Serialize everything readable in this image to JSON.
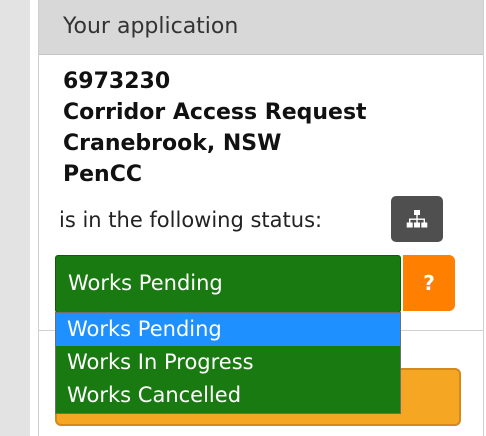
{
  "panel": {
    "title": "Your application"
  },
  "application": {
    "id": "6973230",
    "type": "Corridor Access Request",
    "location": "Cranebrook, NSW",
    "code": "PenCC"
  },
  "status": {
    "label": "is in the following status:",
    "current_value": "Works Pending",
    "options": [
      "Works Pending",
      "Works In Progress",
      "Works Cancelled"
    ],
    "highlighted_option": "Works Pending",
    "help_label": "?"
  },
  "icons": {
    "tree": "sitemap-icon"
  },
  "colors": {
    "select_bg": "#1a7a12",
    "highlight": "#1e90ff",
    "help_button": "#ff7f00",
    "action_button": "#f5a623",
    "header_bg": "#d8d8d8"
  }
}
